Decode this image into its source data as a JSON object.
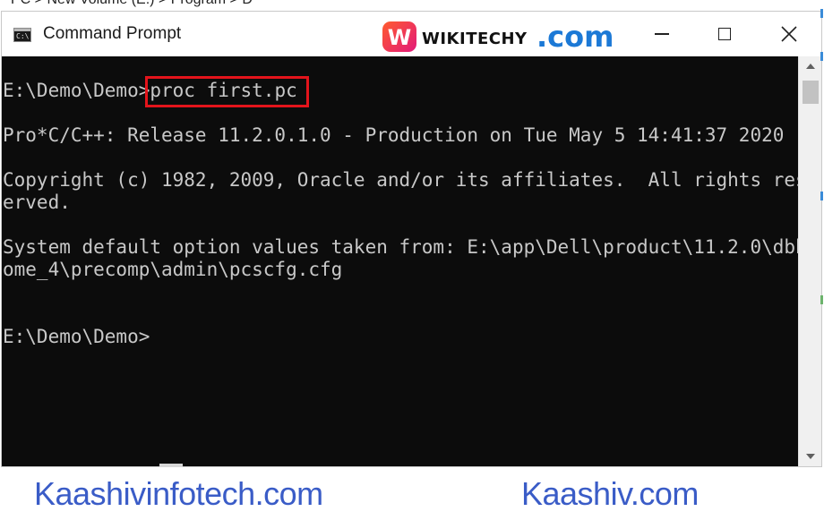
{
  "background_strip": "PC > New Volume (E:) > Program > D",
  "window": {
    "title": "Command Prompt",
    "icon": "console-icon",
    "icon_glyph": "C:\\",
    "controls": {
      "minimize": "minimize-icon",
      "maximize": "maximize-icon",
      "close": "close-icon"
    }
  },
  "watermark": {
    "mark_letter": "W",
    "name": "WIKITECHY",
    "suffix": ".com"
  },
  "console": {
    "prompt": "E:\\Demo\\Demo>",
    "command": "proc first.pc",
    "lines": [
      "Pro*C/C++: Release 11.2.0.1.0 - Production on Tue May 5 14:41:37 2020",
      "Copyright (c) 1982, 2009, Oracle and/or its affiliates.  All rights res",
      "erved.",
      "System default option values taken from: E:\\app\\Dell\\product\\11.2.0\\dbh",
      "ome_4\\precomp\\admin\\pcscfg.cfg"
    ],
    "final_prompt": "E:\\Demo\\Demo>"
  },
  "footer": {
    "link1": "Kaashivinfotech.com",
    "link2": "Kaashiv.com"
  },
  "colors": {
    "console_bg": "#0c0c0c",
    "console_text": "#c8c8c8",
    "highlight_border": "#e3141b",
    "footer_link": "#3a5cc7",
    "logo_com": "#1c79d6"
  }
}
